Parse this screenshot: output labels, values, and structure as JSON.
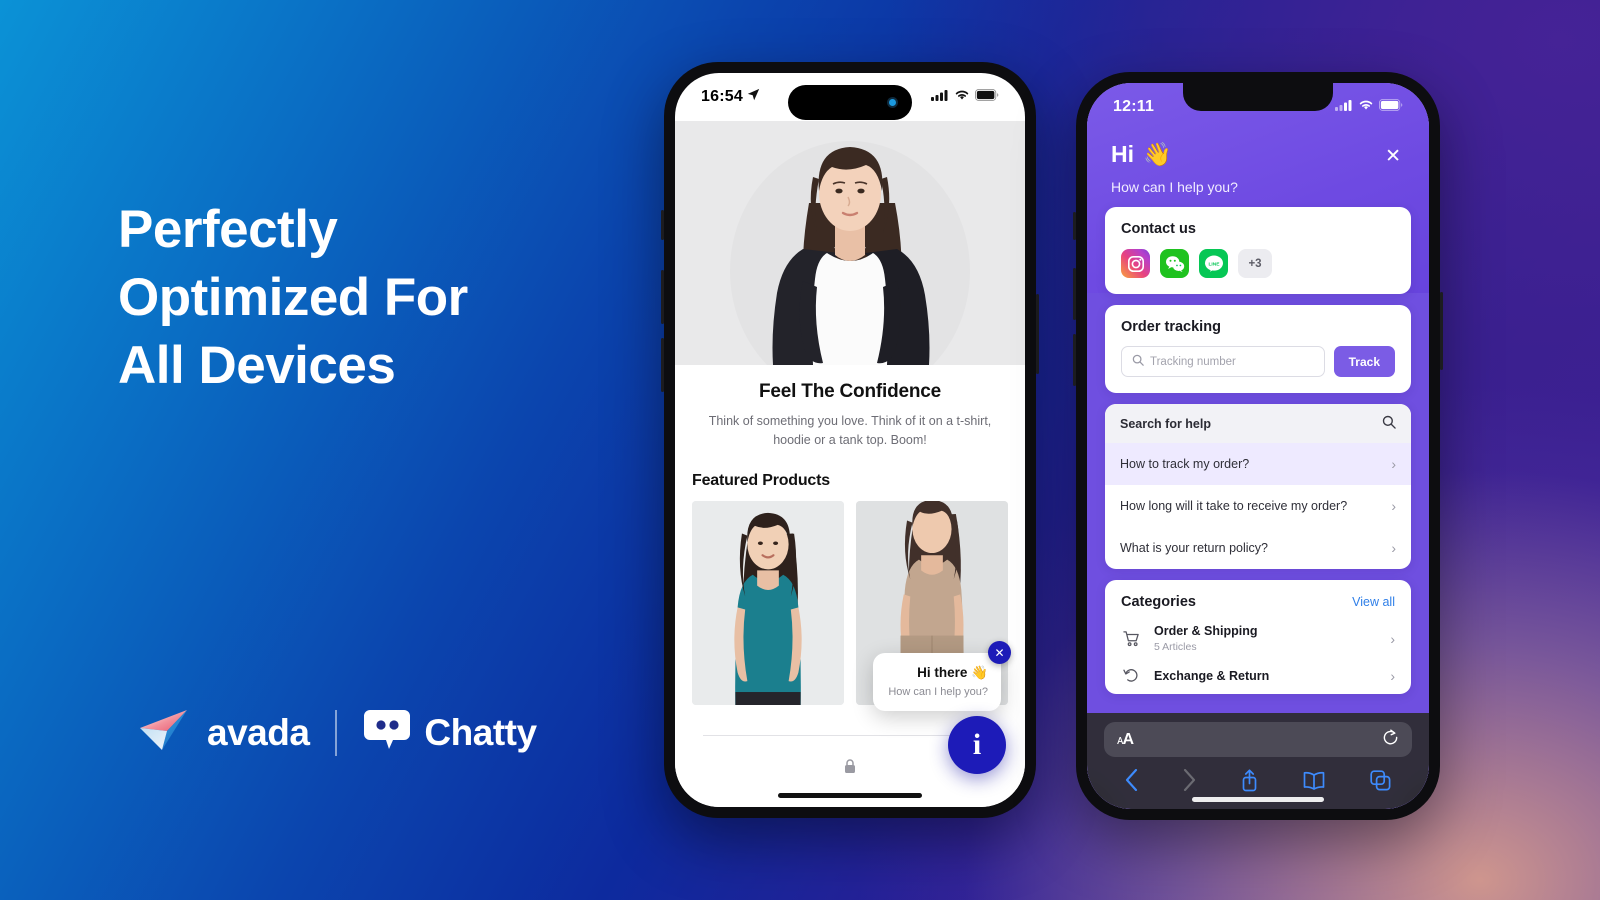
{
  "hero": {
    "headline_lines": [
      "Perfectly",
      "Optimized For",
      "All Devices"
    ]
  },
  "logos": {
    "avada": "avada",
    "chatty": "Chatty",
    "avada_icon": "paper-plane-icon",
    "chatty_icon": "chat-bubble-icon"
  },
  "phone1": {
    "status": {
      "time": "16:54",
      "location_icon": "location-arrow-icon",
      "signal": "signal-bars-icon",
      "wifi": "wifi-icon",
      "battery": "battery-icon"
    },
    "page": {
      "title": "Feel The Confidence",
      "subtitle": "Think of something you love. Think of it on a t-shirt, hoodie or a tank top. Boom!",
      "section_title": "Featured Products",
      "products": [
        {
          "name": "teal-tank-top",
          "alt": "Woman in teal tank top"
        },
        {
          "name": "beige-outfit",
          "alt": "Woman in beige outfit"
        }
      ],
      "lock_icon": "lock-icon"
    },
    "chat_widget": {
      "greeting": "Hi there",
      "greeting_emoji": "👋",
      "prompt": "How can I help you?",
      "close_icon": "close-icon",
      "fab_icon": "info-icon",
      "fab_color": "#1d1bb8"
    }
  },
  "phone2": {
    "status": {
      "time": "12:11",
      "signal": "signal-bars-icon",
      "wifi": "wifi-icon",
      "battery": "battery-icon"
    },
    "header": {
      "greeting": "Hi",
      "greeting_emoji": "👋",
      "subtitle": "How can I help you?",
      "close_icon": "close-icon",
      "bg_color": "#7050e2"
    },
    "contact": {
      "title": "Contact us",
      "channels": [
        {
          "name": "instagram",
          "label": "Instagram"
        },
        {
          "name": "wechat",
          "label": "WeChat"
        },
        {
          "name": "line",
          "label": "LINE"
        }
      ],
      "more_label": "+3"
    },
    "order_tracking": {
      "title": "Order tracking",
      "input_placeholder": "Tracking number",
      "input_value": "",
      "search_icon": "search-icon",
      "button_label": "Track",
      "button_color": "#7b5ce5"
    },
    "help": {
      "search_label": "Search for help",
      "search_icon": "search-icon",
      "faqs": [
        {
          "question": "How to track my order?",
          "active": true
        },
        {
          "question": "How long will it take to receive my order?",
          "active": false
        },
        {
          "question": "What is your return policy?",
          "active": false
        }
      ]
    },
    "categories": {
      "title": "Categories",
      "view_all_label": "View all",
      "items": [
        {
          "name": "Order & Shipping",
          "meta": "5 Articles",
          "icon": "shopping-cart-icon"
        },
        {
          "name": "Exchange & Return",
          "meta": "",
          "icon": "return-arrow-icon"
        }
      ]
    },
    "safari": {
      "aa_label": "AA",
      "reload_icon": "reload-icon",
      "back_icon": "chevron-left-icon",
      "forward_icon": "chevron-right-icon",
      "share_icon": "share-icon",
      "bookmarks_icon": "book-icon",
      "tabs_icon": "tabs-icon"
    }
  }
}
